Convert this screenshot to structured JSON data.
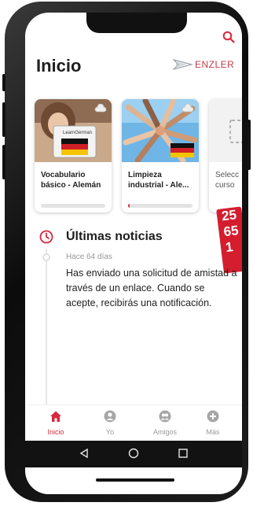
{
  "header": {
    "title": "Inicio",
    "logo_text": "ENZLER"
  },
  "courses": [
    {
      "title": "Vocabulario básico - Alemán",
      "image_label": "LearnGerman",
      "progress": 0.0
    },
    {
      "title": "Limpieza industrial - Ale...",
      "progress": 0.03
    },
    {
      "title": "Selecc\ncurso"
    }
  ],
  "promo": {
    "lines": [
      "25",
      "65",
      "1"
    ]
  },
  "news": {
    "title": "Últimas noticias",
    "date": "Hace 64 días",
    "body": "Has enviado una solicitud de amistad a través de un enlace. Cuando se acepte, recibirás una notificación."
  },
  "nav": {
    "items": [
      {
        "label": "Inicio",
        "icon": "home-icon",
        "active": true
      },
      {
        "label": "Yo",
        "icon": "user-icon",
        "active": false
      },
      {
        "label": "Amigos",
        "icon": "friends-icon",
        "active": false
      },
      {
        "label": "Más",
        "icon": "plus-icon",
        "active": false
      }
    ]
  },
  "colors": {
    "accent": "#d7283c",
    "brand": "#c43a4a"
  }
}
